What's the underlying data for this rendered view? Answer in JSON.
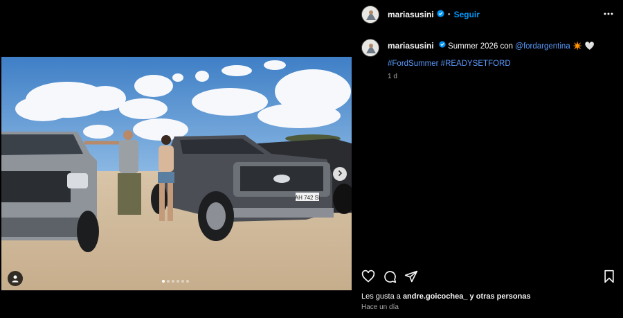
{
  "post": {
    "username": "mariasusini",
    "follow_label": "Seguir",
    "separator": "•",
    "caption_text": "Summer 2026 con",
    "caption_mention": "@fordargentina",
    "caption_emojis": "✴️ 🤍",
    "hashtags": "#FordSummer #READYSETFORD",
    "age": "1 d",
    "likes_prefix": "Les gusta a",
    "likes_user": "andre.goicochea_",
    "likes_suffix": "y otras personas",
    "timestamp": "Hace un día",
    "plate": "AH 742 SI"
  },
  "carousel": {
    "count": 6,
    "active": 0
  },
  "icons": {
    "verified": "verified-badge-icon",
    "more": "more-options-icon",
    "like": "heart-icon",
    "comment": "comment-icon",
    "share": "send-icon",
    "save": "bookmark-icon",
    "next": "chevron-right-icon",
    "tags": "user-tag-icon"
  },
  "colors": {
    "accent": "#0095f6",
    "link": "#5b9bff",
    "background": "#000000"
  }
}
